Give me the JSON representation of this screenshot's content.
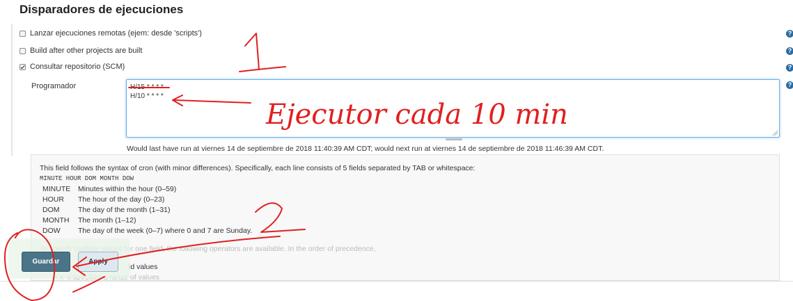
{
  "section": {
    "title": "Disparadores de ejecuciones"
  },
  "triggers": [
    {
      "label": "Lanzar ejecuciones remotas (ejem: desde 'scripts')",
      "checked": false
    },
    {
      "label": "Build after other projects are built",
      "checked": false
    },
    {
      "label": "Consultar repositorio (SCM)",
      "checked": true
    }
  ],
  "help_icon": "?",
  "schedule": {
    "label": "Programador",
    "lines": [
      "H/15 * * * *",
      "H/10 * * * *"
    ],
    "next_run": "Would last have run at viernes 14 de septiembre de 2018 11:40:39 AM CDT; would next run at viernes 14 de septiembre de 2018 11:46:39 AM CDT."
  },
  "help": {
    "intro": "This field follows the syntax of cron (with minor differences). Specifically, each line consists of 5 fields separated by TAB or whitespace:",
    "syntax": "MINUTE HOUR DOM MONTH DOW",
    "fields": [
      {
        "name": "MINUTE",
        "desc": "Minutes within the hour (0–59)"
      },
      {
        "name": "HOUR",
        "desc": "The hour of the day (0–23)"
      },
      {
        "name": "DOM",
        "desc": "The day of the month (1–31)"
      },
      {
        "name": "MONTH",
        "desc": "The month (1–12)"
      },
      {
        "name": "DOW",
        "desc": "The day of the week (0–7) where 0 and 7 are Sunday."
      }
    ],
    "operators_intro": "To specify multiple values for one field, the following operators are available. In the order of precedence,",
    "bullet_partial": "id values",
    "bullet_range_code": "M-N",
    "bullet_range_text": "specifies a range of values"
  },
  "buttons": {
    "save": "Guardar",
    "apply": "Apply"
  },
  "annotations": {
    "step1": "1",
    "step2": "2",
    "note": "Ejecutor cada 10 min",
    "ink_color": "#e02020"
  }
}
